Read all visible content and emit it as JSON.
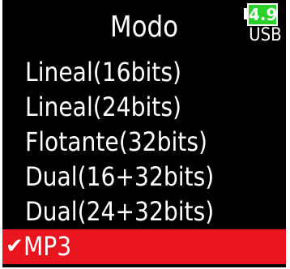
{
  "header": {
    "title": "Modo",
    "battery_level": "4.9",
    "power_source": "USB"
  },
  "colors": {
    "background": "#000000",
    "text": "#ffffff",
    "selected_row": "#e8141e",
    "battery_fill": "#2bd12b"
  },
  "menu": {
    "items": [
      {
        "label": "Lineal(16bits)",
        "selected": false
      },
      {
        "label": "Lineal(24bits)",
        "selected": false
      },
      {
        "label": "Flotante(32bits)",
        "selected": false
      },
      {
        "label": "Dual(16+32bits)",
        "selected": false
      },
      {
        "label": "Dual(24+32bits)",
        "selected": false
      },
      {
        "label": "MP3",
        "selected": true
      }
    ],
    "check_icon": "check-icon"
  }
}
